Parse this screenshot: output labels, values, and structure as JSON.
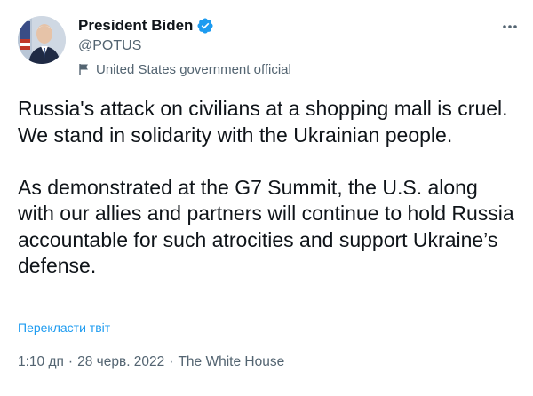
{
  "author": {
    "display_name": "President Biden",
    "handle": "@POTUS",
    "label": "United States government official",
    "verified": true
  },
  "icons": {
    "verified": "verified-badge-icon",
    "label": "flag-icon",
    "more": "more-options-icon"
  },
  "tweet": {
    "paragraphs": [
      "Russia's attack on civilians at a shopping mall is cruel. We stand in solidarity with the Ukrainian people.",
      "As demonstrated at the G7 Summit, the U.S. along with our allies and partners will continue to hold Russia accountable for such atrocities and support Ukraine’s defense."
    ],
    "translate_label": "Перекласти твіт"
  },
  "meta": {
    "time": "1:10 дп",
    "separator": "·",
    "date": "28 черв. 2022",
    "source": "The White House"
  },
  "colors": {
    "accent": "#1d9bf0",
    "text": "#0f1419",
    "secondary": "#536471"
  }
}
